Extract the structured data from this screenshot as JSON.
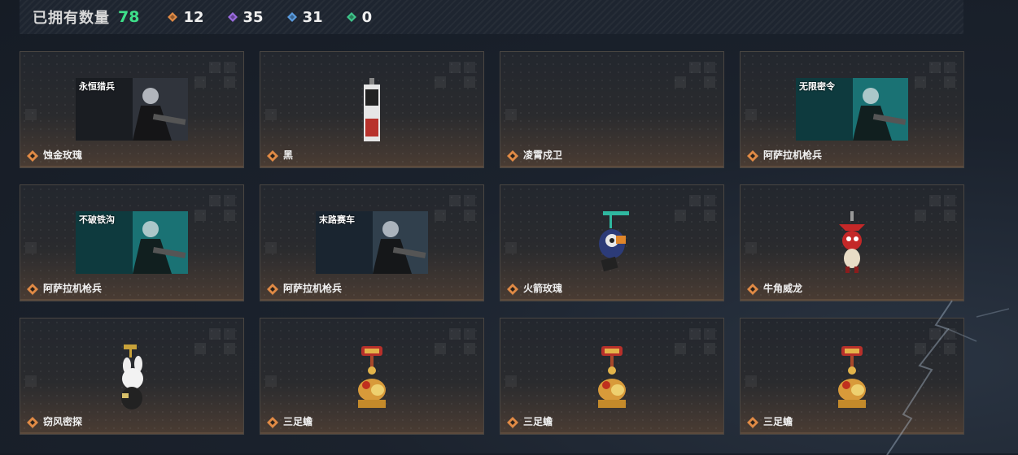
{
  "header": {
    "owned_label": "已拥有数量",
    "owned_total": "78",
    "stats": [
      {
        "icon": "orange-diamond-icon",
        "color": "#e08a45",
        "value": "12"
      },
      {
        "icon": "purple-diamond-icon",
        "color": "#9a6be0",
        "value": "35"
      },
      {
        "icon": "blue-diamond-icon",
        "color": "#5a9ce0",
        "value": "31"
      },
      {
        "icon": "green-diamond-icon",
        "color": "#3ec48a",
        "value": "0"
      }
    ]
  },
  "items": [
    {
      "name": "蚀金玫瑰",
      "art": "banner",
      "banner_title": "永恒猎兵",
      "theme": "dark"
    },
    {
      "name": "黑",
      "art": "tag",
      "theme": "red"
    },
    {
      "name": "凌霄戍卫",
      "art": "none"
    },
    {
      "name": "阿萨拉机枪兵",
      "art": "banner",
      "banner_title": "无限密令",
      "theme": "teal"
    },
    {
      "name": "阿萨拉机枪兵",
      "art": "banner",
      "banner_title": "不破铁沟",
      "theme": "teal"
    },
    {
      "name": "阿萨拉机枪兵",
      "art": "banner",
      "banner_title": "末路赛车",
      "theme": "bluegray"
    },
    {
      "name": "火箭玫瑰",
      "art": "charm-rocket"
    },
    {
      "name": "牛角威龙",
      "art": "charm-dragon"
    },
    {
      "name": "窃风密探",
      "art": "charm-bunny"
    },
    {
      "name": "三足蟾",
      "art": "charm-toad"
    },
    {
      "name": "三足蟾",
      "art": "charm-toad"
    },
    {
      "name": "三足蟾",
      "art": "charm-toad"
    }
  ],
  "colors": {
    "rarity_orange": "#e08a45",
    "accent_green": "#3ee08a"
  }
}
